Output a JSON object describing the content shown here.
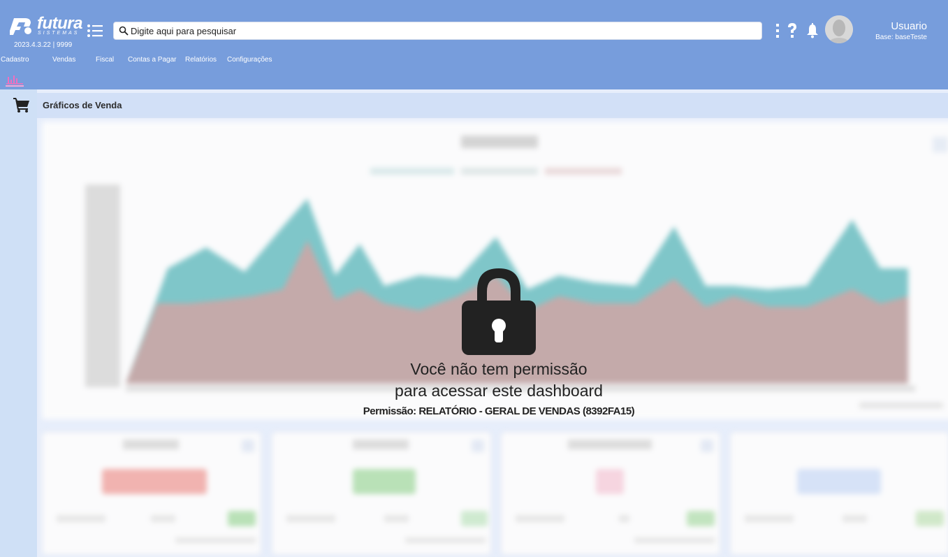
{
  "brand": {
    "name": "futura",
    "sub": "SISTEMAS"
  },
  "version": "2023.4.3.22 | 9999",
  "search": {
    "placeholder": "Digite aqui para pesquisar"
  },
  "user": {
    "name": "Usuario",
    "base": "Base: baseTeste"
  },
  "nav": {
    "items": [
      "Cadastro",
      "Vendas",
      "Fiscal",
      "Contas a Pagar",
      "Relatórios",
      "Configurações"
    ]
  },
  "page": {
    "title": "Gráficos de Venda"
  },
  "lock_message": {
    "line1": "Você não tem permissão",
    "line2": "para acessar este dashboard",
    "permission": "Permissão: RELATÓRIO - GERAL DE VENDAS (8392FA15)"
  },
  "colors": {
    "header": "#779ddc",
    "rail": "#cfe0f6",
    "teal_series": "#7fc6c9",
    "rose_series": "#c4aaaa"
  }
}
